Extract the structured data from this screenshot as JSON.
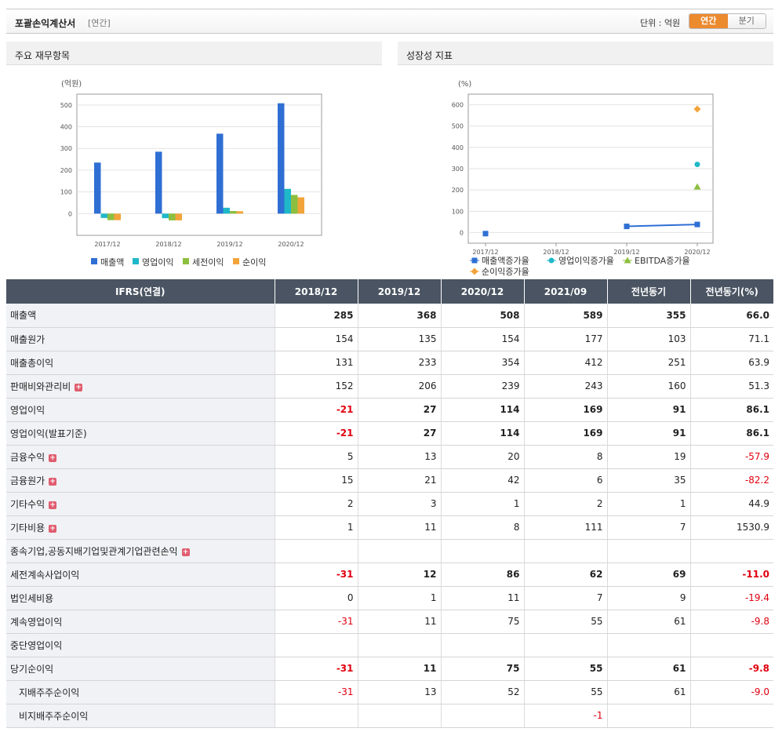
{
  "header": {
    "title": "포괄손익계산서",
    "subtitle": "[연간]",
    "unit_label": "단위 : 억원",
    "tabs": [
      "연간",
      "분기"
    ]
  },
  "panels": {
    "left_title": "주요 재무항목",
    "right_title": "성장성 지표"
  },
  "chart_data": [
    {
      "type": "bar",
      "unit_label": "(억원)",
      "categories": [
        "2017/12",
        "2018/12",
        "2019/12",
        "2020/12"
      ],
      "ylim": [
        -100,
        550
      ],
      "yticks": [
        0,
        100,
        200,
        300,
        400,
        500
      ],
      "grid": true,
      "legend_position": "bottom",
      "series": [
        {
          "name": "매출액",
          "color": "#2f6fd4",
          "values": [
            235,
            285,
            368,
            508
          ]
        },
        {
          "name": "영업이익",
          "color": "#1fb8c8",
          "values": [
            -20,
            -21,
            27,
            114
          ]
        },
        {
          "name": "세전이익",
          "color": "#8cbf3f",
          "values": [
            -30,
            -31,
            12,
            86
          ]
        },
        {
          "name": "순이익",
          "color": "#f2a43a",
          "values": [
            -30,
            -31,
            11,
            75
          ]
        }
      ]
    },
    {
      "type": "line",
      "unit_label": "(%)",
      "categories": [
        "2017/12",
        "2018/12",
        "2019/12",
        "2020/12"
      ],
      "ylim": [
        -50,
        650
      ],
      "yticks": [
        0,
        100,
        200,
        300,
        400,
        500,
        600
      ],
      "grid": true,
      "legend_position": "bottom",
      "series": [
        {
          "name": "매출액증가율",
          "color": "#2f6fd4",
          "marker": "square",
          "values": [
            -5,
            null,
            29,
            38
          ]
        },
        {
          "name": "영업이익증가율",
          "color": "#1fb8c8",
          "marker": "circle",
          "values": [
            null,
            null,
            null,
            320
          ]
        },
        {
          "name": "EBITDA증가율",
          "color": "#8cbf3f",
          "marker": "triangle",
          "values": [
            null,
            null,
            null,
            215
          ]
        },
        {
          "name": "순이익증가율",
          "color": "#f2a43a",
          "marker": "diamond",
          "values": [
            null,
            null,
            null,
            580
          ]
        }
      ]
    }
  ],
  "table": {
    "columns": [
      "IFRS(연결)",
      "2018/12",
      "2019/12",
      "2020/12",
      "2021/09",
      "전년동기",
      "전년동기(%)"
    ],
    "rows": [
      {
        "label": "매출액",
        "bold": true,
        "values": [
          "285",
          "368",
          "508",
          "589",
          "355",
          "66.0"
        ]
      },
      {
        "label": "매출원가",
        "values": [
          "154",
          "135",
          "154",
          "177",
          "103",
          "71.1"
        ]
      },
      {
        "label": "매출총이익",
        "values": [
          "131",
          "233",
          "354",
          "412",
          "251",
          "63.9"
        ]
      },
      {
        "label": "판매비와관리비",
        "plus": true,
        "values": [
          "152",
          "206",
          "239",
          "243",
          "160",
          "51.3"
        ]
      },
      {
        "label": "영업이익",
        "bold": true,
        "values": [
          "-21",
          "27",
          "114",
          "169",
          "91",
          "86.1"
        ]
      },
      {
        "label": "영업이익(발표기준)",
        "bold": true,
        "values": [
          "-21",
          "27",
          "114",
          "169",
          "91",
          "86.1"
        ]
      },
      {
        "label": "금융수익",
        "plus": true,
        "values": [
          "5",
          "13",
          "20",
          "8",
          "19",
          "-57.9"
        ]
      },
      {
        "label": "금융원가",
        "plus": true,
        "values": [
          "15",
          "21",
          "42",
          "6",
          "35",
          "-82.2"
        ]
      },
      {
        "label": "기타수익",
        "plus": true,
        "values": [
          "2",
          "3",
          "1",
          "2",
          "1",
          "44.9"
        ]
      },
      {
        "label": "기타비용",
        "plus": true,
        "values": [
          "1",
          "11",
          "8",
          "111",
          "7",
          "1530.9"
        ]
      },
      {
        "label": "종속기업,공동지배기업및관계기업관련손익",
        "plus": true,
        "values": [
          "",
          "",
          "",
          "",
          "",
          ""
        ]
      },
      {
        "label": "세전계속사업이익",
        "bold": true,
        "values": [
          "-31",
          "12",
          "86",
          "62",
          "69",
          "-11.0"
        ]
      },
      {
        "label": "법인세비용",
        "values": [
          "0",
          "1",
          "11",
          "7",
          "9",
          "-19.4"
        ]
      },
      {
        "label": "계속영업이익",
        "values": [
          "-31",
          "11",
          "75",
          "55",
          "61",
          "-9.8"
        ]
      },
      {
        "label": "중단영업이익",
        "values": [
          "",
          "",
          "",
          "",
          "",
          ""
        ]
      },
      {
        "label": "당기순이익",
        "bold": true,
        "values": [
          "-31",
          "11",
          "75",
          "55",
          "61",
          "-9.8"
        ]
      },
      {
        "label": "지배주주순이익",
        "indent": true,
        "values": [
          "-31",
          "13",
          "52",
          "55",
          "61",
          "-9.0"
        ]
      },
      {
        "label": "비지배주주순이익",
        "indent": true,
        "values": [
          "",
          "",
          "",
          "-1",
          "",
          ""
        ]
      }
    ]
  }
}
